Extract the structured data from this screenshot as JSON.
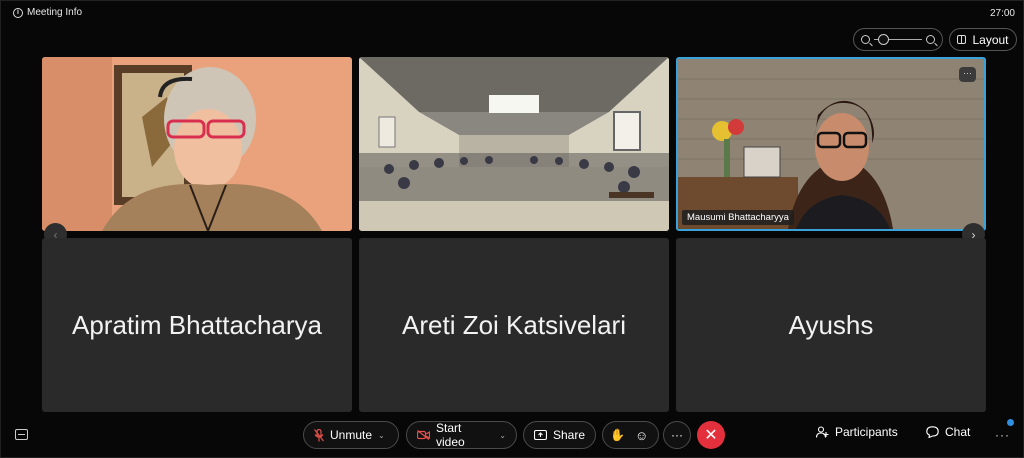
{
  "top_bar": {
    "meeting_info_label": "Meeting Info",
    "timer": "27:00",
    "layout_label": "Layout"
  },
  "participants": [
    {
      "name": "Apratim Bhattacharya"
    },
    {
      "name": "Areti Zoi Katsivelari"
    },
    {
      "name": "Ayushs"
    }
  ],
  "video_tiles": {
    "active_speaker_label": "Mausumi Bhattacharyya",
    "more_label": "···"
  },
  "toolbar": {
    "unmute_label": "Unmute",
    "start_video_label": "Start video",
    "share_label": "Share",
    "more_label": "···",
    "end_label": "✕",
    "participants_label": "Participants",
    "chat_label": "Chat",
    "overflow_label": "···"
  },
  "colors": {
    "accent_active": "#39a3d9",
    "end_call": "#e3303c",
    "muted_icon": "#e5514a",
    "tile_bg": "#2a2a2a"
  }
}
